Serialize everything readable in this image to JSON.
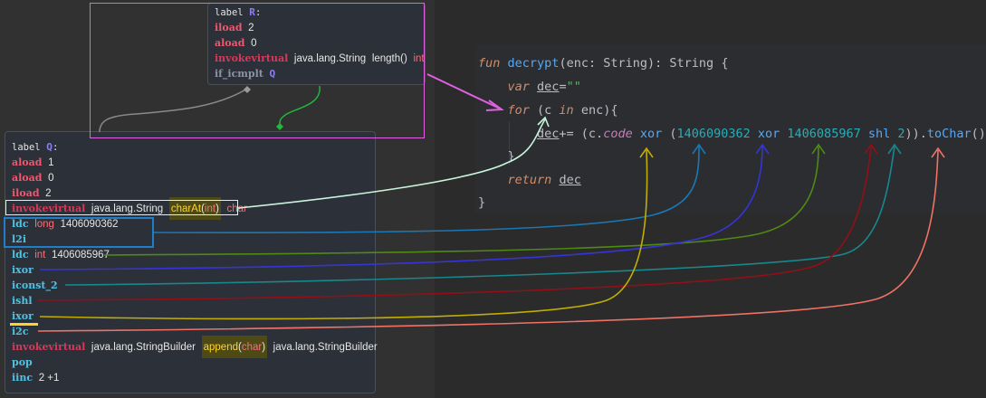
{
  "bytecode": {
    "node_r": {
      "label_keyword": "label",
      "label_name": "R",
      "lines": [
        {
          "op": "iload",
          "arg": "2"
        },
        {
          "op": "aload",
          "arg": "0"
        },
        {
          "op": "invokevirtual",
          "owner": "java.lang.String",
          "method": "length()",
          "ret": "int"
        },
        {
          "op": "if_icmplt",
          "target": "Q"
        }
      ]
    },
    "node_q": {
      "label_keyword": "label",
      "label_name": "Q",
      "lines": [
        {
          "op": "aload",
          "arg": "1"
        },
        {
          "op": "aload",
          "arg": "0"
        },
        {
          "op": "iload",
          "arg": "2"
        },
        {
          "op": "invokevirtual",
          "owner": "java.lang.String",
          "method": "charAt",
          "paren_open": "(",
          "param": "int",
          "paren_close": ")",
          "ret": "char"
        },
        {
          "op": "ldc",
          "type": "long",
          "arg": "1406090362"
        },
        {
          "op": "l2i"
        },
        {
          "op": "ldc",
          "type": "int",
          "arg": "1406085967"
        },
        {
          "op": "ixor"
        },
        {
          "op": "iconst_2"
        },
        {
          "op": "ishl"
        },
        {
          "op": "ixor"
        },
        {
          "op": "i2c"
        },
        {
          "op": "invokevirtual",
          "owner": "java.lang.StringBuilder",
          "method": "append",
          "paren_open": "(",
          "param": "char",
          "paren_close": ")",
          "ret": "java.lang.StringBuilder"
        },
        {
          "op": "pop"
        },
        {
          "op": "iinc",
          "arg": "2 +1"
        }
      ]
    }
  },
  "kotlin": {
    "line1": {
      "fun": "fun",
      "name": "decrypt",
      "open": "(",
      "param": "enc",
      "colon": ": ",
      "ptype": "String",
      "close": ")",
      "colon2": ": ",
      "rtype": "String",
      "brace": " {"
    },
    "line2": {
      "var": "var",
      "name": "dec",
      "eq": "=",
      "str": "\"\""
    },
    "line3": {
      "for": "for",
      "open": " (c ",
      "in": "in",
      "rest": " enc){"
    },
    "line4": {
      "target": "dec",
      "op": "+= (c.",
      "code": "code",
      "xor1": " xor ",
      "open": "(",
      "n1": "1406090362",
      "xor2": " xor ",
      "n2": "1406085967",
      "shl": " shl ",
      "n3": "2",
      "close": ")).",
      "tochar": "toChar",
      "paren": "()"
    },
    "line5": {
      "brace": "}"
    },
    "line6": {
      "ret": "return",
      "name": "dec"
    },
    "line7": {
      "brace": "}"
    }
  },
  "colors": {
    "charat_arrow": "#c8f5dc",
    "l2i_arrow": "#1b78b5",
    "ldc_int_arrow": "#4f8a12",
    "ixor1_arrow": "#3535d6",
    "iconst_arrow": "#16888e",
    "ishl_arrow": "#930f18",
    "ixor2_arrow": "#c2ae00",
    "i2c_arrow": "#f07166",
    "selection_box": "#e061e2",
    "flow_arrow": "#1fb73c"
  }
}
